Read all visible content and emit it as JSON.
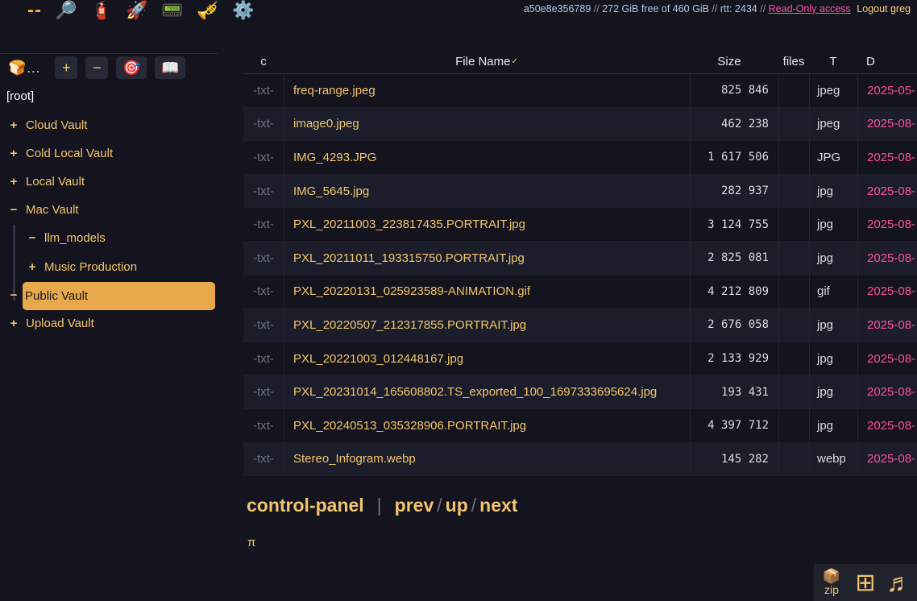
{
  "topbar": {
    "icons": [
      {
        "name": "dash-icon",
        "glyph": "--"
      },
      {
        "name": "search-icon",
        "glyph": "🔎"
      },
      {
        "name": "fire-extinguisher-icon",
        "glyph": "🧯"
      },
      {
        "name": "rocket-icon",
        "glyph": "🚀"
      },
      {
        "name": "pager-icon",
        "glyph": "📟"
      },
      {
        "name": "trumpet-icon",
        "glyph": "🎺"
      },
      {
        "name": "gear-icon",
        "glyph": "⚙️"
      }
    ],
    "server_id": "a50e8e356789",
    "sep": "//",
    "disk": "272 GiB free of 460 GiB",
    "rtt": "rtt: 2434",
    "readonly": "Read-Only access",
    "logout": "Logout greg"
  },
  "tree": {
    "toolbar": {
      "bread": "🍞…",
      "plus": "+",
      "minus": "−",
      "target": "🎯",
      "panel": "📖"
    },
    "root": "[root]",
    "items": [
      {
        "pm": "+",
        "label": "Cloud Vault"
      },
      {
        "pm": "+",
        "label": "Cold Local Vault"
      },
      {
        "pm": "+",
        "label": "Local Vault"
      },
      {
        "pm": "−",
        "label": "Mac Vault"
      },
      {
        "pm": "−",
        "label": "llm_models"
      },
      {
        "pm": "+",
        "label": "Music Production"
      },
      {
        "pm": "−",
        "label": "Public Vault"
      },
      {
        "pm": "+",
        "label": "Upload Vault"
      }
    ]
  },
  "table": {
    "headers": {
      "c": "c",
      "name": "File Name",
      "sort": "✓",
      "size": "Size",
      "files": "files",
      "t": "T",
      "d": "D"
    },
    "rows": [
      {
        "c": "-txt-",
        "name": "freq-range.jpeg",
        "size": "825 846",
        "t": "jpeg",
        "date": "2025-05-"
      },
      {
        "c": "-txt-",
        "name": "image0.jpeg",
        "size": "462 238",
        "t": "jpeg",
        "date": "2025-08-"
      },
      {
        "c": "-txt-",
        "name": "IMG_4293.JPG",
        "size": "1 617 506",
        "t": "JPG",
        "date": "2025-08-"
      },
      {
        "c": "-txt-",
        "name": "IMG_5645.jpg",
        "size": "282 937",
        "t": "jpg",
        "date": "2025-08-"
      },
      {
        "c": "-txt-",
        "name": "PXL_20211003_223817435.PORTRAIT.jpg",
        "size": "3 124 755",
        "t": "jpg",
        "date": "2025-08-"
      },
      {
        "c": "-txt-",
        "name": "PXL_20211011_193315750.PORTRAIT.jpg",
        "size": "2 825 081",
        "t": "jpg",
        "date": "2025-08-"
      },
      {
        "c": "-txt-",
        "name": "PXL_20220131_025923589-ANIMATION.gif",
        "size": "4 212 809",
        "t": "gif",
        "date": "2025-08-"
      },
      {
        "c": "-txt-",
        "name": "PXL_20220507_212317855.PORTRAIT.jpg",
        "size": "2 676 058",
        "t": "jpg",
        "date": "2025-08-"
      },
      {
        "c": "-txt-",
        "name": "PXL_20221003_012448167.jpg",
        "size": "2 133 929",
        "t": "jpg",
        "date": "2025-08-"
      },
      {
        "c": "-txt-",
        "name": "PXL_20231014_165608802.TS_exported_100_1697333695624.jpg",
        "size": "193 431",
        "t": "jpg",
        "date": "2025-08-"
      },
      {
        "c": "-txt-",
        "name": "PXL_20240513_035328906.PORTRAIT.jpg",
        "size": "4 397 712",
        "t": "jpg",
        "date": "2025-08-"
      },
      {
        "c": "-txt-",
        "name": "Stereo_Infogram.webp",
        "size": "145 282",
        "t": "webp",
        "date": "2025-08-"
      }
    ]
  },
  "nav": {
    "control_panel": "control-panel",
    "bar": "|",
    "prev": "prev",
    "slash": "/",
    "up": "up",
    "next": "next",
    "pi": "π"
  },
  "widgets": {
    "zip_icon": "📦",
    "zip_label": "zip",
    "grid_icon": "⊞",
    "music_icon": "♬"
  },
  "colors": {
    "background": "#14141e",
    "accent": "#f2c46d",
    "selected": "#e8a94c",
    "date": "#ff4f9a",
    "readonly": "#ff4faa"
  }
}
